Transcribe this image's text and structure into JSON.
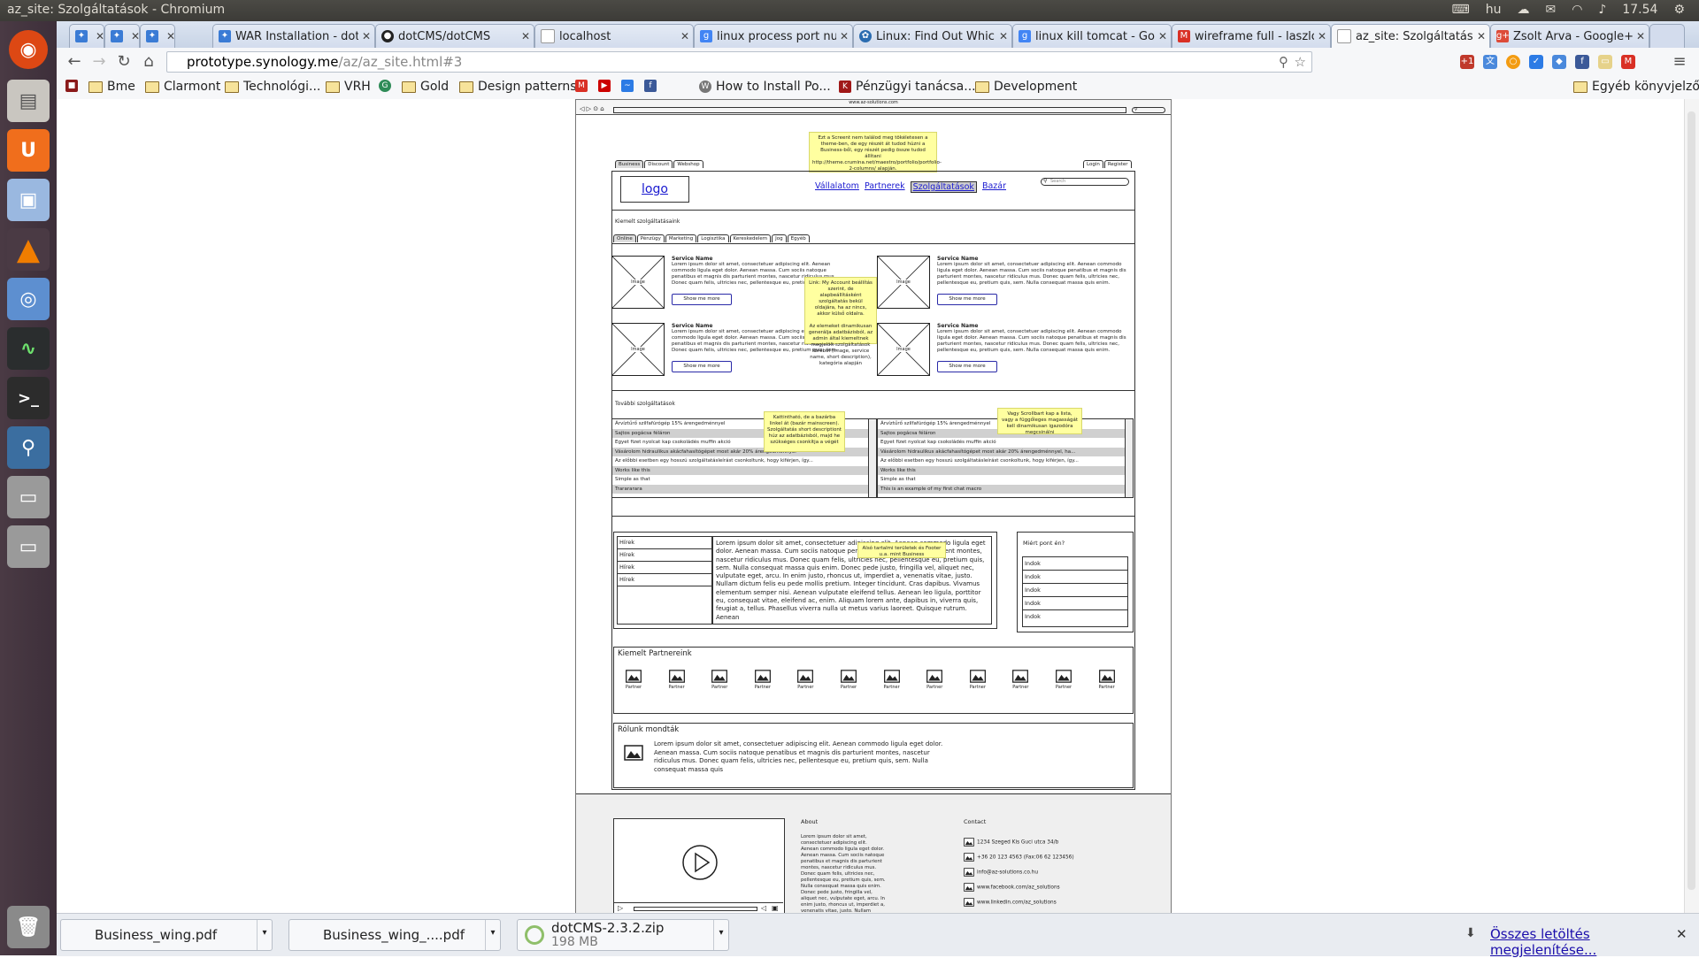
{
  "system_bar": {
    "window_title": "az_site: Szolgáltatások - Chromium",
    "keyboard_layout": "hu",
    "clock": "17.54"
  },
  "launcher": {
    "items": [
      "ubuntu-logo-icon",
      "files-icon",
      "ubuntu-one-icon",
      "virtualbox-icon",
      "vlc-icon",
      "chromium-icon",
      "system-monitor-icon",
      "terminal-icon",
      "pgadmin-elephant-icon",
      "drive-icon",
      "drive-icon",
      "trash-icon"
    ]
  },
  "tabs": [
    {
      "label": ""
    },
    {
      "label": ""
    },
    {
      "label": ""
    },
    {
      "label": "WAR Installation - dotCMS"
    },
    {
      "label": "dotCMS/dotCMS"
    },
    {
      "label": "localhost"
    },
    {
      "label": "linux process port number"
    },
    {
      "label": "Linux: Find Out Which Port"
    },
    {
      "label": "linux kill tomcat - Google"
    },
    {
      "label": "wireframe full - laszlo.h"
    },
    {
      "label": "az_site: Szolgáltatások"
    },
    {
      "label": "Zsolt Árva - Google+"
    }
  ],
  "address_bar": {
    "host": "prototype.synology.me",
    "path": "/az/az_site.html#3"
  },
  "bookmarks": [
    {
      "label": "",
      "type": "app"
    },
    {
      "label": "Bme",
      "type": "folder"
    },
    {
      "label": "Clarmont",
      "type": "folder"
    },
    {
      "label": "Technológi...",
      "type": "folder"
    },
    {
      "label": "VRH",
      "type": "folder"
    },
    {
      "label": "",
      "type": "site"
    },
    {
      "label": "Gold",
      "type": "folder"
    },
    {
      "label": "Design patterns",
      "type": "folder"
    },
    {
      "label": "",
      "type": "gmail"
    },
    {
      "label": "",
      "type": "youtube"
    },
    {
      "label": "",
      "type": "site"
    },
    {
      "label": "",
      "type": "facebook"
    },
    {
      "label": "How to Install Po...",
      "type": "wordpress"
    },
    {
      "label": "Pénzügyi tanácsa...",
      "type": "site"
    },
    {
      "label": "Development",
      "type": "folder"
    },
    {
      "label": "Egyéb könyvjelzők",
      "type": "folder"
    }
  ],
  "mock": {
    "url_text": "www.az-solutions.com",
    "top_note": "Ezt a Screent nem találod meg tökéletesen a theme-ben, de egy részét át tudod húzni a Business-ből, egy részét pedig össze tudod állítani http://theme.crumina.net/maestro/portfolio/portfolio-2-columns/ alapján.",
    "site_tabs": [
      "Business",
      "Discount",
      "Webshop"
    ],
    "auth_tabs": [
      "Login",
      "Register"
    ],
    "logo": "logo",
    "nav": [
      "Vállalatom",
      "Partnerek",
      "Szolgáltatások",
      "Bazár"
    ],
    "search_placeholder": "Search",
    "featured_title": "Kiemelt szolgáltatásaink",
    "categories": [
      "Online",
      "Pénzügy",
      "Marketing",
      "Logisztika",
      "Kereskedelem",
      "Jog",
      "Egyéb"
    ],
    "image_label": "Image",
    "service_name": "Service Name",
    "service_text": "Lorem ipsum dolor sit amet, consectetuer adipiscing elit. Aenean commodo ligula eget dolor. Aenean massa. Cum sociis natoque penatibus et magnis dis parturient montes, nascetur ridiculus mus. Donec quam felis, ultricies nec, pellentesque eu, pretium quis, sem. Nulla consequat massa quis enim.",
    "show_more": "Show me more",
    "middle_note": "Link: My Account beállítás szerint, de alapbeállításként szolgáltatás bekül oldajára, ha az nincs, akkor külső oldalra.\n\nAz elemeket dinamikusan generálja adatbázisból, az admin által kiemeltnek megjelölt szolgáltatások köréből (image, service name, short description), kategória alapján",
    "more_title": "További szolgáltatások",
    "list_note_left": "Kattintható, de a bazárba linkel át (bazár mainscreen). Szolgáltatás short descriptiont húz az adatbázisból, majd he szükséges csonkítja a végét",
    "list_note_right": "Vagy Scrollbart kap a lista, vagy a függőleges magasságát kell dinamikusan igazodóra megcsinálni",
    "list_left": [
      "Árvíztűrő szilfafúrógép 15% árengedménnyel",
      "Sajtos pogácsa féláron",
      "Egyet fizet nyolcat kap csokoládés muffin akció",
      "Vásárolom hidraulikus akácfahasítógépet most akár 20% árengedménnyel",
      "Az előbbi esetben egy hosszú szolgáltatásleírást csonkoltunk, hogy kiférjen, így...",
      "Works like this",
      "Simple as that",
      "Trarararara"
    ],
    "list_right": [
      "Árvíztűrő szilfafúrógép 15% árengedménnyel",
      "Sajtos pogácsa féláron",
      "Egyet fizet nyolcat kap csokoládés muffin akció",
      "Vásárolom hidraulikus akácfahasítógépet most akár 20% árengedménnyel, ha...",
      "Az előbbi esetben egy hosszú szolgáltatásleírást csonkoltunk, hogy kiférjen, így...",
      "Works like this",
      "Simple as that",
      "This is an example of my first chat macro"
    ],
    "news_items": [
      "Hírek",
      "Hírek",
      "Hírek",
      "Hírek"
    ],
    "news_text": "Lorem ipsum dolor sit amet, consectetuer adipiscing elit. Aenean commodo ligula eget dolor. Aenean massa. Cum sociis natoque penatibus et magnis dis parturient montes, nascetur ridiculus mus. Donec quam felis, ultricies nec, pellentesque eu, pretium quis, sem. Nulla consequat massa quis enim. Donec pede justo, fringilla vel, aliquet nec, vulputate eget, arcu. In enim justo, rhoncus ut, imperdiet a, venenatis vitae, justo. Nullam dictum felis eu pede mollis pretium. Integer tincidunt. Cras dapibus. Vivamus elementum semper nisi. Aenean vulputate eleifend tellus. Aenean leo ligula, porttitor eu, consequat vitae, eleifend ac, enim. Aliquam lorem ante, dapibus in, viverra quis, feugiat a, tellus. Phasellus viverra nulla ut metus varius laoreet. Quisque rutrum. Aenean",
    "news_note": "Alsó tartalmi területek és Footer u.a. mint Business",
    "why_title": "Miért pont én?",
    "why_items": [
      "Indok",
      "Indok",
      "Indok",
      "Indok",
      "Indok"
    ],
    "partners_title": "Kiemelt Partnereink",
    "partner_label": "Partner",
    "partner_count": 12,
    "testimonials_title": "Rólunk mondták",
    "testimonial_text": "Lorem ipsum dolor sit amet, consectetuer adipiscing elit. Aenean commodo ligula eget dolor. Aenean massa. Cum sociis natoque penatibus et magnis dis parturient montes, nascetur ridiculus mus. Donec quam felis, ultricies nec, pellentesque eu, pretium quis, sem. Nulla consequat massa quis",
    "footer_about_title": "About",
    "footer_about_text": "Lorem ipsum dolor sit amet, consectetuer adipiscing elit. Aenean commodo ligula eget dolor. Aenean massa. Cum sociis natoque penatibus et magnis dis parturient montes, nascetur ridiculus mus. Donec quam felis, ultricies nec, pellentesque eu, pretium quis, sem. Nulla consequat massa quis enim. Donec pede justo, fringilla vel, aliquet nec, vulputate eget, arcu. In enim justo, rhoncus ut, imperdiet a, venenatis vitae, justo. Nullam dictum felis eu pede mollis pretium. Integer tincidunt. Cras dapibus. Vivamus elementum semper nisi. Aenean vulputate eleifend tellus. Aenean leo ligula, porttitor eu, consequat vitae, eleifend ac, enim. Aliquam lorem ante, dapibus in, viverra quis, feugiat a, tellus.",
    "footer_contact_title": "Contact",
    "contacts": [
      "1234 Szeged Kis Guci utca 34/b",
      "+36 20 123 4563 (Fax:06 62 123456)",
      "info@az-solutions.co.hu",
      "www.facebook.com/az_solutions",
      "www.linkedin.com/az_solutions"
    ]
  },
  "downloads": {
    "items": [
      {
        "name": "Business_wing.pdf",
        "size": ""
      },
      {
        "name": "Business_wing_....pdf",
        "size": ""
      },
      {
        "name": "dotCMS-2.3.2.zip",
        "size": "198 MB"
      }
    ],
    "show_all": "Összes letöltés megjelenítése..."
  }
}
